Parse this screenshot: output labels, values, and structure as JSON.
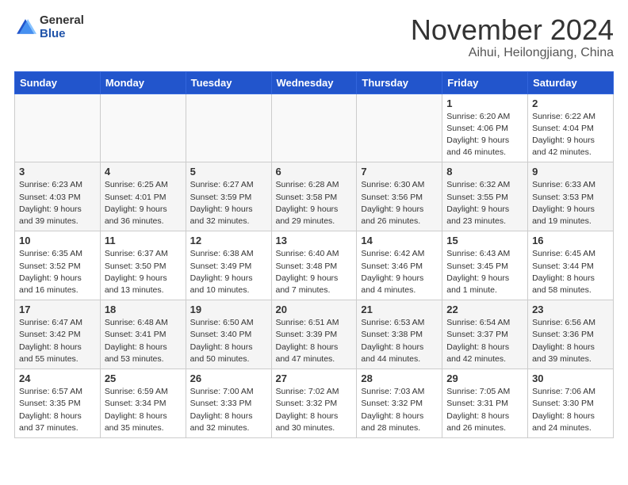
{
  "header": {
    "logo_general": "General",
    "logo_blue": "Blue",
    "month_title": "November 2024",
    "location": "Aihui, Heilongjiang, China"
  },
  "days_of_week": [
    "Sunday",
    "Monday",
    "Tuesday",
    "Wednesday",
    "Thursday",
    "Friday",
    "Saturday"
  ],
  "weeks": [
    [
      {
        "day": "",
        "info": ""
      },
      {
        "day": "",
        "info": ""
      },
      {
        "day": "",
        "info": ""
      },
      {
        "day": "",
        "info": ""
      },
      {
        "day": "",
        "info": ""
      },
      {
        "day": "1",
        "info": "Sunrise: 6:20 AM\nSunset: 4:06 PM\nDaylight: 9 hours and 46 minutes."
      },
      {
        "day": "2",
        "info": "Sunrise: 6:22 AM\nSunset: 4:04 PM\nDaylight: 9 hours and 42 minutes."
      }
    ],
    [
      {
        "day": "3",
        "info": "Sunrise: 6:23 AM\nSunset: 4:03 PM\nDaylight: 9 hours and 39 minutes."
      },
      {
        "day": "4",
        "info": "Sunrise: 6:25 AM\nSunset: 4:01 PM\nDaylight: 9 hours and 36 minutes."
      },
      {
        "day": "5",
        "info": "Sunrise: 6:27 AM\nSunset: 3:59 PM\nDaylight: 9 hours and 32 minutes."
      },
      {
        "day": "6",
        "info": "Sunrise: 6:28 AM\nSunset: 3:58 PM\nDaylight: 9 hours and 29 minutes."
      },
      {
        "day": "7",
        "info": "Sunrise: 6:30 AM\nSunset: 3:56 PM\nDaylight: 9 hours and 26 minutes."
      },
      {
        "day": "8",
        "info": "Sunrise: 6:32 AM\nSunset: 3:55 PM\nDaylight: 9 hours and 23 minutes."
      },
      {
        "day": "9",
        "info": "Sunrise: 6:33 AM\nSunset: 3:53 PM\nDaylight: 9 hours and 19 minutes."
      }
    ],
    [
      {
        "day": "10",
        "info": "Sunrise: 6:35 AM\nSunset: 3:52 PM\nDaylight: 9 hours and 16 minutes."
      },
      {
        "day": "11",
        "info": "Sunrise: 6:37 AM\nSunset: 3:50 PM\nDaylight: 9 hours and 13 minutes."
      },
      {
        "day": "12",
        "info": "Sunrise: 6:38 AM\nSunset: 3:49 PM\nDaylight: 9 hours and 10 minutes."
      },
      {
        "day": "13",
        "info": "Sunrise: 6:40 AM\nSunset: 3:48 PM\nDaylight: 9 hours and 7 minutes."
      },
      {
        "day": "14",
        "info": "Sunrise: 6:42 AM\nSunset: 3:46 PM\nDaylight: 9 hours and 4 minutes."
      },
      {
        "day": "15",
        "info": "Sunrise: 6:43 AM\nSunset: 3:45 PM\nDaylight: 9 hours and 1 minute."
      },
      {
        "day": "16",
        "info": "Sunrise: 6:45 AM\nSunset: 3:44 PM\nDaylight: 8 hours and 58 minutes."
      }
    ],
    [
      {
        "day": "17",
        "info": "Sunrise: 6:47 AM\nSunset: 3:42 PM\nDaylight: 8 hours and 55 minutes."
      },
      {
        "day": "18",
        "info": "Sunrise: 6:48 AM\nSunset: 3:41 PM\nDaylight: 8 hours and 53 minutes."
      },
      {
        "day": "19",
        "info": "Sunrise: 6:50 AM\nSunset: 3:40 PM\nDaylight: 8 hours and 50 minutes."
      },
      {
        "day": "20",
        "info": "Sunrise: 6:51 AM\nSunset: 3:39 PM\nDaylight: 8 hours and 47 minutes."
      },
      {
        "day": "21",
        "info": "Sunrise: 6:53 AM\nSunset: 3:38 PM\nDaylight: 8 hours and 44 minutes."
      },
      {
        "day": "22",
        "info": "Sunrise: 6:54 AM\nSunset: 3:37 PM\nDaylight: 8 hours and 42 minutes."
      },
      {
        "day": "23",
        "info": "Sunrise: 6:56 AM\nSunset: 3:36 PM\nDaylight: 8 hours and 39 minutes."
      }
    ],
    [
      {
        "day": "24",
        "info": "Sunrise: 6:57 AM\nSunset: 3:35 PM\nDaylight: 8 hours and 37 minutes."
      },
      {
        "day": "25",
        "info": "Sunrise: 6:59 AM\nSunset: 3:34 PM\nDaylight: 8 hours and 35 minutes."
      },
      {
        "day": "26",
        "info": "Sunrise: 7:00 AM\nSunset: 3:33 PM\nDaylight: 8 hours and 32 minutes."
      },
      {
        "day": "27",
        "info": "Sunrise: 7:02 AM\nSunset: 3:32 PM\nDaylight: 8 hours and 30 minutes."
      },
      {
        "day": "28",
        "info": "Sunrise: 7:03 AM\nSunset: 3:32 PM\nDaylight: 8 hours and 28 minutes."
      },
      {
        "day": "29",
        "info": "Sunrise: 7:05 AM\nSunset: 3:31 PM\nDaylight: 8 hours and 26 minutes."
      },
      {
        "day": "30",
        "info": "Sunrise: 7:06 AM\nSunset: 3:30 PM\nDaylight: 8 hours and 24 minutes."
      }
    ]
  ]
}
